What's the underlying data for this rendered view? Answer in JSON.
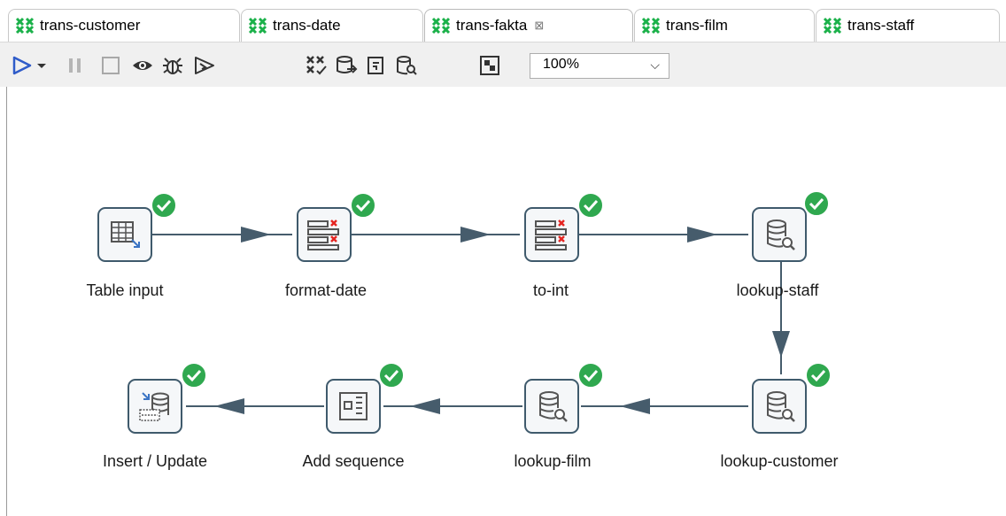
{
  "tabs": [
    {
      "label": "trans-customer",
      "active": false
    },
    {
      "label": "trans-date",
      "active": false
    },
    {
      "label": "trans-fakta",
      "active": true,
      "close_glyph": "⊠"
    },
    {
      "label": "trans-film",
      "active": false
    },
    {
      "label": "trans-staff",
      "active": false
    }
  ],
  "toolbar": {
    "zoom_value": "100%",
    "zoom_arrow": "⌵",
    "buttons": [
      "run-icon",
      "run-dropdown-icon",
      "pause-icon",
      "stop-icon",
      "preview-icon",
      "debug-icon",
      "replay-icon",
      "verify-icon",
      "impact-icon",
      "sql-icon",
      "explore-db-icon",
      "grid-toggle-icon"
    ]
  },
  "colors": {
    "accent_green": "#2fa84f",
    "node_border": "#3f5a6c",
    "hop_line": "#465c6c",
    "error_red": "#e52521",
    "tab_icon_green": "#1bb14a"
  },
  "steps": [
    {
      "name": "Table input",
      "icon": "table-input-icon"
    },
    {
      "name": "format-date",
      "icon": "select-values-icon"
    },
    {
      "name": "to-int",
      "icon": "select-values-icon"
    },
    {
      "name": "lookup-staff",
      "icon": "db-lookup-icon"
    },
    {
      "name": "lookup-customer",
      "icon": "db-lookup-icon"
    },
    {
      "name": "lookup-film",
      "icon": "db-lookup-icon"
    },
    {
      "name": "Add sequence",
      "icon": "add-sequence-icon"
    },
    {
      "name": "Insert / Update",
      "icon": "insert-update-icon"
    }
  ]
}
